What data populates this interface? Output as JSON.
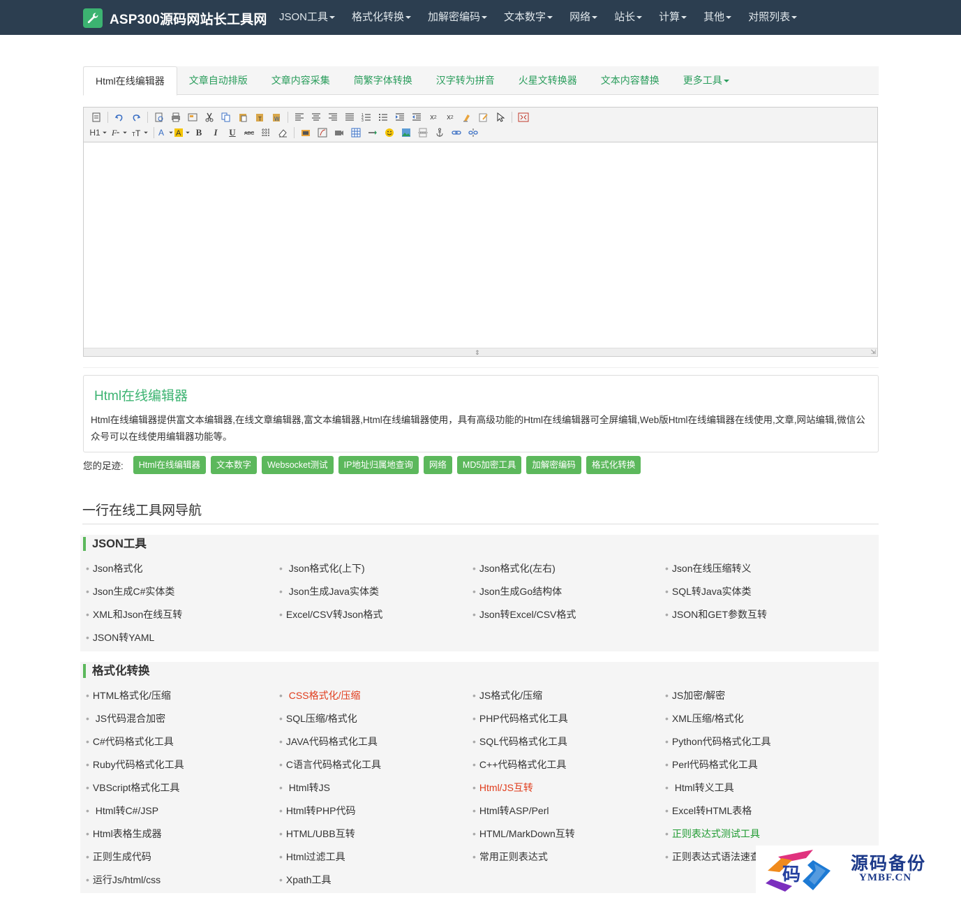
{
  "header": {
    "brand": "ASP300源码网站长工具网",
    "menu": [
      "JSON工具",
      "格式化转换",
      "加解密编码",
      "文本数字",
      "网络",
      "站长",
      "计算",
      "其他",
      "对照列表"
    ]
  },
  "tabs": {
    "items": [
      "Html在线编辑器",
      "文章自动排版",
      "文章内容采集",
      "简繁字体转换",
      "汉字转为拼音",
      "火星文转换器",
      "文本内容替换",
      "更多工具"
    ],
    "active": 0
  },
  "editor": {
    "toolbar_row2_labels": {
      "heading": "H1",
      "bold": "B",
      "italic": "I",
      "underline": "U"
    }
  },
  "description": {
    "title": "Html在线编辑器",
    "text": "Html在线编辑器提供富文本编辑器,在线文章编辑器,富文本编辑器,Html在线编辑器使用，具有高级功能的Html在线编辑器可全屏编辑,Web版Html在线编辑器在线使用,文章,网站编辑,微信公众号可以在线使用编辑器功能等。"
  },
  "footprint": {
    "label": "您的足迹:",
    "tags": [
      "Html在线编辑器",
      "文本数字",
      "Websocket测试",
      "IP地址归属地查询",
      "网络",
      "MD5加密工具",
      "加解密编码",
      "格式化转换"
    ]
  },
  "nav_section": {
    "heading": "一行在线工具网导航"
  },
  "categories": [
    {
      "title": "JSON工具",
      "links": [
        "Json格式化",
        " Json格式化(上下)",
        "Json格式化(左右)",
        "Json在线压缩转义",
        "Json生成C#实体类",
        " Json生成Java实体类",
        "Json生成Go结构体",
        "SQL转Java实体类",
        "XML和Json在线互转",
        "Excel/CSV转Json格式",
        "Json转Excel/CSV格式",
        "JSON和GET参数互转",
        "JSON转YAML"
      ]
    },
    {
      "title": "格式化转换",
      "links": [
        "HTML格式化/压缩",
        " CSS格式化/压缩",
        "JS格式化/压缩",
        "JS加密/解密",
        " JS代码混合加密",
        "SQL压缩/格式化",
        "PHP代码格式化工具",
        "XML压缩/格式化",
        "C#代码格式化工具",
        "JAVA代码格式化工具",
        "SQL代码格式化工具",
        "Python代码格式化工具",
        "Ruby代码格式化工具",
        "C语言代码格式化工具",
        "C++代码格式化工具",
        "Perl代码格式化工具",
        "VBScript格式化工具",
        " Html转JS",
        "Html/JS互转",
        " Html转义工具",
        " Html转C#/JSP",
        "Html转PHP代码",
        "Html转ASP/Perl",
        "Excel转HTML表格",
        "Html表格生成器",
        "HTML/UBB互转",
        "HTML/MarkDown互转",
        "正则表达式测试工具",
        "正则生成代码",
        "Html过滤工具",
        "常用正则表达式",
        "正则表达式语法速查",
        "运行Js/html/css",
        "Xpath工具"
      ],
      "highlight_red": [
        1,
        18
      ],
      "highlight_green": [
        27
      ]
    }
  ],
  "watermark": {
    "cn": "源码备份",
    "en": "YMBF.CN",
    "logo_char": "码"
  },
  "colors": {
    "topbar": "#2c3e50",
    "accent_green": "#3cb371",
    "tag_green": "#5cb85c",
    "link_red": "#e03c1c"
  }
}
